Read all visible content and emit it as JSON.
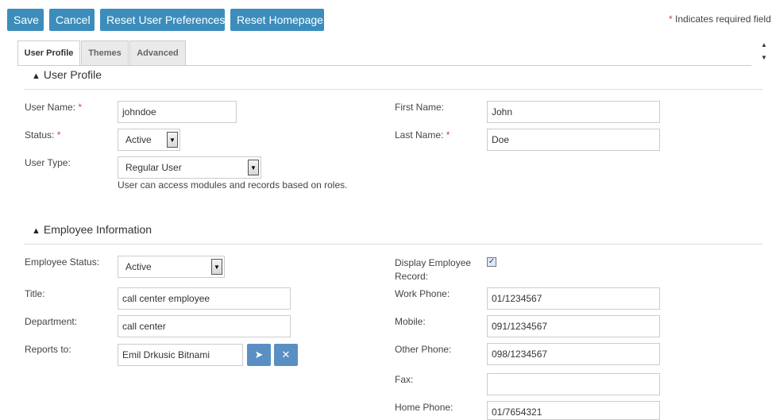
{
  "toolbar": {
    "save_label": "Save",
    "cancel_label": "Cancel",
    "reset_prefs_label": "Reset User Preferences",
    "reset_home_label": "Reset Homepage"
  },
  "required_note": {
    "star": "*",
    "text": "Indicates required field"
  },
  "tabs": [
    {
      "label": "User Profile",
      "active": true
    },
    {
      "label": "Themes",
      "active": false
    },
    {
      "label": "Advanced",
      "active": false
    }
  ],
  "user_profile": {
    "title": "User Profile",
    "user_name": {
      "label": "User Name:",
      "required": "*",
      "value": "johndoe"
    },
    "first_name": {
      "label": "First Name:",
      "value": "John"
    },
    "status": {
      "label": "Status:",
      "required": "*",
      "value": "Active"
    },
    "last_name": {
      "label": "Last Name:",
      "required": "*",
      "value": "Doe"
    },
    "user_type": {
      "label": "User Type:",
      "value": "Regular User",
      "help": "User can access modules and records based on roles."
    }
  },
  "employee_info": {
    "title": "Employee Information",
    "employee_status": {
      "label": "Employee Status:",
      "value": "Active"
    },
    "display_record": {
      "label_line1": "Display Employee",
      "label_line2": "Record:",
      "checked": true
    },
    "title_field": {
      "label": "Title:",
      "value": "call center employee"
    },
    "work_phone": {
      "label": "Work Phone:",
      "value": "01/1234567"
    },
    "department": {
      "label": "Department:",
      "value": "call center"
    },
    "mobile": {
      "label": "Mobile:",
      "value": "091/1234567"
    },
    "reports_to": {
      "label": "Reports to:",
      "value": "Emil Drkusic Bitnami"
    },
    "other_phone": {
      "label": "Other Phone:",
      "value": "098/1234567"
    },
    "fax": {
      "label": "Fax:",
      "value": ""
    },
    "home_phone": {
      "label": "Home Phone:",
      "value": "01/7654321"
    }
  },
  "colors": {
    "button_bg": "#3c8dbc",
    "required_star": "#e03a3a",
    "icon_button_bg": "#5a8fc4"
  },
  "icons": {
    "section_toggle": "chevron-up-icon",
    "select_user": "cursor-arrow-icon",
    "clear_user": "clear-x-icon"
  }
}
